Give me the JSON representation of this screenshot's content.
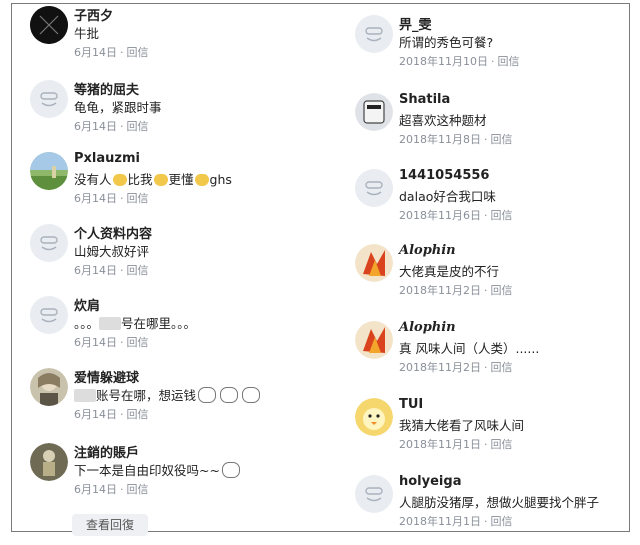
{
  "left_comments": [
    {
      "user": "子西夕",
      "text": "牛批",
      "date": "6月14日",
      "reply": "回信",
      "avatar": "dark"
    },
    {
      "user": "等猪的屈夫",
      "text": "龟龟，紧跟时事",
      "date": "6月14日",
      "reply": "回信",
      "avatar": "default"
    },
    {
      "user": "Pxlauzmi",
      "text_parts": [
        "没有人",
        "比我",
        "更懂",
        "ghs"
      ],
      "date": "6月14日",
      "reply": "回信",
      "avatar": "landscape"
    },
    {
      "user": "个人资料内容",
      "text": "山姆大叔好评",
      "date": "6月14日",
      "reply": "回信",
      "avatar": "default"
    },
    {
      "user": "炊肩",
      "text_parts": [
        "。。。",
        "号在哪里。。。"
      ],
      "date": "6月14日",
      "reply": "回信",
      "avatar": "default"
    },
    {
      "user": "爱情躲避球",
      "text_parts": [
        "账号在哪，想运钱"
      ],
      "date": "6月14日",
      "reply": "回信",
      "avatar": "girl"
    },
    {
      "user": "注銷的賬戶",
      "text": "下一本是自由印奴役吗~~",
      "date": "6月14日",
      "reply": "回信",
      "avatar": "figure"
    }
  ],
  "right_comments": [
    {
      "user": "畀_雯",
      "text": "所谓的秀色可餐?",
      "date": "2018年11月10日",
      "reply": "回信",
      "avatar": "default"
    },
    {
      "user": "Shatila",
      "text": "超喜欢这种题材",
      "date": "2018年11月8日",
      "reply": "回信",
      "avatar": "robot"
    },
    {
      "user": "1441054556",
      "text": "dalao好合我口味",
      "date": "2018年11月6日",
      "reply": "回信",
      "avatar": "default"
    },
    {
      "user": "Alophin",
      "text": "大佬真是皮的不行",
      "date": "2018年11月2日",
      "reply": "回信",
      "avatar": "fire"
    },
    {
      "user": "Alophin",
      "text": "真 风味人间（人类）......",
      "date": "2018年11月2日",
      "reply": "回信",
      "avatar": "fire"
    },
    {
      "user": "TUI",
      "text": "我猜大佬看了风味人间",
      "date": "2018年11月1日",
      "reply": "回信",
      "avatar": "bird"
    },
    {
      "user": "holyeiga",
      "text": "人腿肪没猪厚，想做火腿要找个胖子",
      "date": "2018年11月1日",
      "reply": "回信",
      "avatar": "default"
    }
  ],
  "more_replies_label": "查看回復",
  "colors": {
    "meta": "#8a8f99",
    "text": "#222222",
    "avatar_bg": "#e9edf2"
  }
}
